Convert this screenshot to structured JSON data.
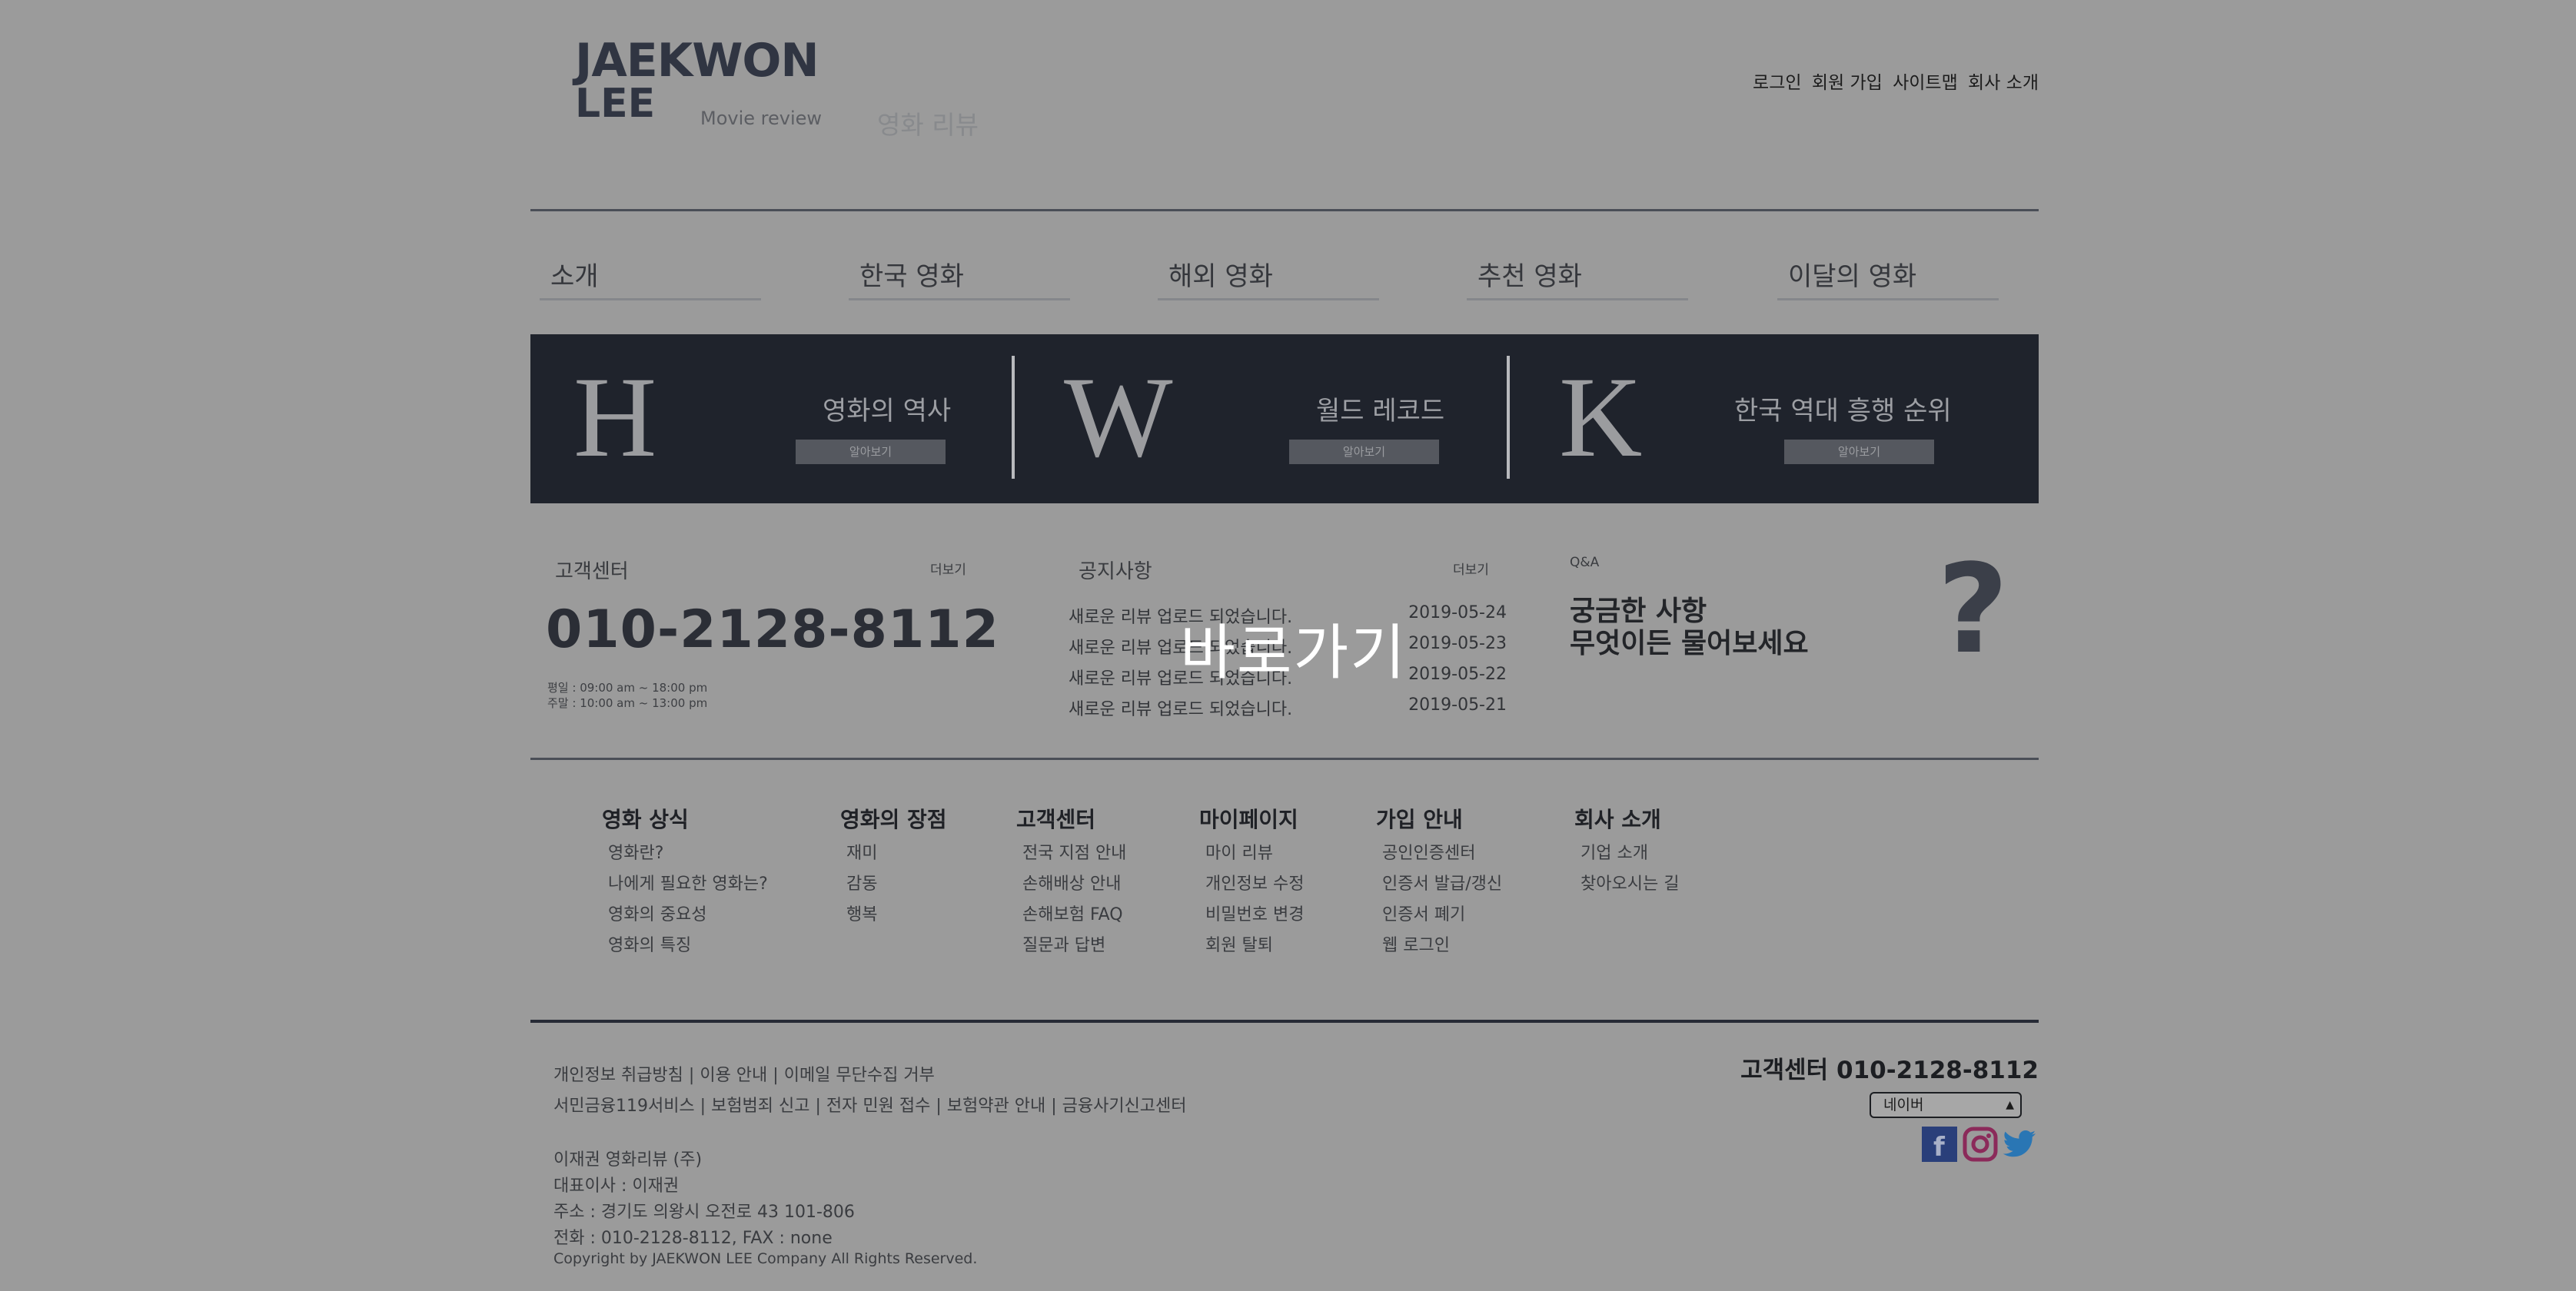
{
  "header": {
    "logo_line1": "JAEKWON",
    "logo_line2": "LEE",
    "logo_sub": "Movie review",
    "logo_kr": "영화 리뷰",
    "util_links": [
      "로그인",
      "회원 가입",
      "사이트맵",
      "회사 소개"
    ]
  },
  "nav": {
    "items": [
      "소개",
      "한국 영화",
      "해외 영화",
      "추천 영화",
      "이달의 영화"
    ]
  },
  "banner": {
    "items": [
      {
        "letter": "H",
        "title": "영화의 역사",
        "button": "알아보기"
      },
      {
        "letter": "W",
        "title": "월드 레코드",
        "button": "알아보기"
      },
      {
        "letter": "K",
        "title": "한국 역대 흥행 순위",
        "button": "알아보기"
      }
    ]
  },
  "customer_center": {
    "label": "고객센터",
    "more": "더보기",
    "phone": "010-2128-8112",
    "hours_weekday": "평일 : 09:00 am ~ 18:00 pm",
    "hours_weekend": "주말 : 10:00 am ~  13:00 pm"
  },
  "notices": {
    "label": "공지사항",
    "more": "더보기",
    "items": [
      {
        "title": "새로운 리뷰 업로드 되었습니다.",
        "date": "2019-05-24"
      },
      {
        "title": "새로운 리뷰 업로드 되었습니다.",
        "date": "2019-05-23"
      },
      {
        "title": "새로운 리뷰 업로드 되었습니다.",
        "date": "2019-05-22"
      },
      {
        "title": "새로운 리뷰 업로드 되었습니다.",
        "date": "2019-05-21"
      }
    ]
  },
  "qa": {
    "label": "Q&A",
    "line1": "궁금한 사항",
    "line2": "무엇이든 물어보세요",
    "mark": "?"
  },
  "overlay_text": "바로가기",
  "sitemap": [
    {
      "heading": "영화 상식",
      "links": [
        "영화란?",
        "나에게 필요한 영화는?",
        "영화의 중요성",
        "영화의 특징"
      ]
    },
    {
      "heading": "영화의 장점",
      "links": [
        "재미",
        "감동",
        "행복"
      ]
    },
    {
      "heading": "고객센터",
      "links": [
        "전국 지점 안내",
        "손해배상 안내",
        "손해보험 FAQ",
        "질문과 답변"
      ]
    },
    {
      "heading": "마이페이지",
      "links": [
        "마이 리뷰",
        "개인정보 수정",
        "비밀번호 변경",
        "회원 탈퇴"
      ]
    },
    {
      "heading": "가입 안내",
      "links": [
        "공인인증센터",
        "인증서 발급/갱신",
        "인증서 폐기",
        "웹 로그인"
      ]
    },
    {
      "heading": "회사 소개",
      "links": [
        "기업 소개",
        "찾아오시는 길"
      ]
    }
  ],
  "footer": {
    "links_row1": [
      "개인정보 취급방침",
      "이용 안내",
      "이메일 무단수집 거부"
    ],
    "links_row2": [
      "서민금융119서비스",
      "보험범죄 신고",
      "전자 민원 접수",
      "보험약관 안내",
      "금융사기신고센터"
    ],
    "company": "이재권 영화리뷰 (주)",
    "ceo": "대표이사 : 이재권",
    "address": "주소 : 경기도 의왕시 오전로 43 101-806",
    "contact": "전화 : 010-2128-8112, FAX : none",
    "copyright": "Copyright by JAEKWON LEE Company All Rights Reserved.",
    "cs_phone": "고객센터 010-2128-8112",
    "select_value": "네이버",
    "sns": [
      "facebook-icon",
      "instagram-icon",
      "twitter-icon"
    ]
  }
}
